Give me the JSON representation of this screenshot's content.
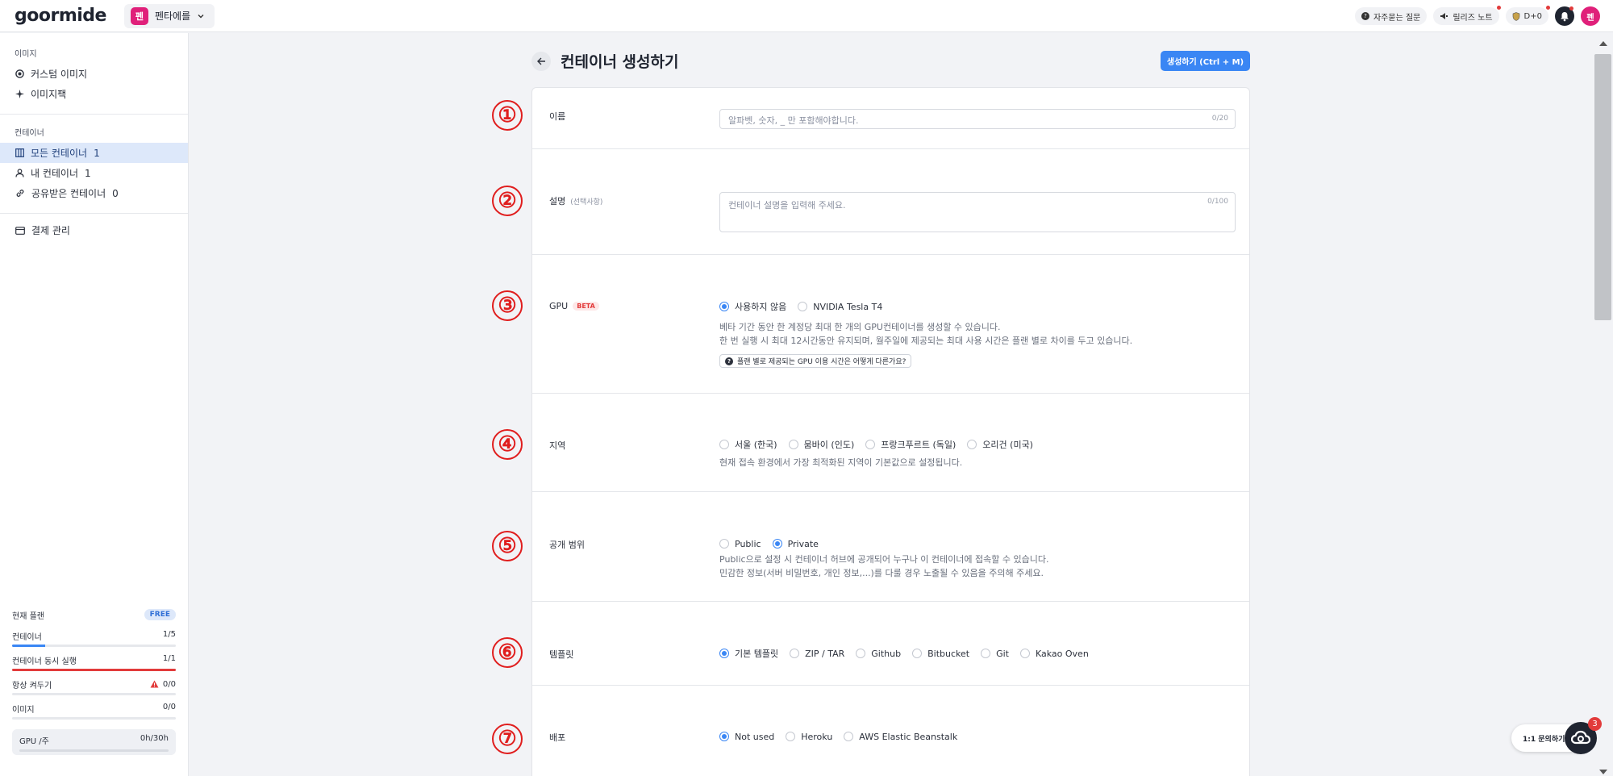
{
  "topbar": {
    "logo": "goormide",
    "org_badge": "펜",
    "org_name": "펜타에를",
    "faq": "자주묻는 질문",
    "release": "릴리즈 노트",
    "dday": "D+0",
    "avatar": "펜",
    "bell_badge": "0"
  },
  "sidebar": {
    "image_section": "이미지",
    "image_items": [
      {
        "label": "커스텀 이미지",
        "icon": "circle-dot-icon"
      },
      {
        "label": "이미지팩",
        "icon": "sparkle-icon"
      }
    ],
    "container_section": "컨테이너",
    "container_items": [
      {
        "label": "모든 컨테이너",
        "count": "1",
        "icon": "grid-icon",
        "active": true
      },
      {
        "label": "내 컨테이너",
        "count": "1",
        "icon": "user-icon"
      },
      {
        "label": "공유받은 컨테이너",
        "count": "0",
        "icon": "link-icon"
      }
    ],
    "billing": "결제 관리",
    "plan": {
      "title": "현재 플랜",
      "badge": "FREE",
      "rows": [
        {
          "label": "컨테이너",
          "value": "1/5",
          "fill": 0.2,
          "color": "#3a86f4"
        },
        {
          "label": "컨테이너 동시 실행",
          "value": "1/1",
          "fill": 1.0,
          "color": "#e23b3b"
        },
        {
          "label": "항상 켜두기",
          "value": "0/0",
          "fill": 0,
          "color": "#3a86f4",
          "warn": true
        },
        {
          "label": "이미지",
          "value": "0/0",
          "fill": 0,
          "color": "#3a86f4"
        }
      ],
      "gpu_label": "GPU /주",
      "gpu_value": "0h/30h"
    }
  },
  "main": {
    "title": "컨테이너 생성하기",
    "create_button": "생성하기 (Ctrl + M)",
    "name": {
      "number": "①",
      "label": "이름",
      "placeholder": "알파벳, 숫자, _ 만 포함해야합니다.",
      "counter": "0/20"
    },
    "description": {
      "number": "②",
      "label": "설명",
      "optional": "(선택사항)",
      "placeholder": "컨테이너 설명을 입력해 주세요.",
      "counter": "0/100"
    },
    "gpu": {
      "number": "③",
      "label": "GPU",
      "beta": "BETA",
      "options": [
        "사용하지 않음",
        "NVIDIA Tesla T4"
      ],
      "selected": 0,
      "help1": "베타 기간 동안 한 계정당 최대 한 개의 GPU컨테이너를 생성할 수 있습니다.",
      "help2": "한 번 실행 시 최대 12시간동안 유지되며, 월주일에 제공되는 최대 사용 시간은 플랜 별로 차이를 두고 있습니다.",
      "question": "플랜 별로 제공되는 GPU 이용 시간은 어떻게 다른가요?"
    },
    "region": {
      "number": "④",
      "label": "지역",
      "options": [
        "서울 (한국)",
        "뭄바이 (인도)",
        "프랑크푸르트 (독일)",
        "오리건 (미국)"
      ],
      "selected": -1,
      "help": "현재 접속 환경에서 가장 최적화된 지역이 기본값으로 설정됩니다."
    },
    "visibility": {
      "number": "⑤",
      "label": "공개 범위",
      "options": [
        "Public",
        "Private"
      ],
      "selected": 1,
      "help1": "Public으로 설정 시 컨테이너 허브에 공개되어 누구나 이 컨테이너에 접속할 수 있습니다.",
      "help2": "민감한 정보(서버 비밀번호, 개인 정보,...)를 다룰 경우 노출될 수 있음을 주의해 주세요."
    },
    "template": {
      "number": "⑥",
      "label": "템플릿",
      "options": [
        "기본 템플릿",
        "ZIP / TAR",
        "Github",
        "Bitbucket",
        "Git",
        "Kakao Oven"
      ],
      "selected": 0
    },
    "deploy": {
      "number": "⑦",
      "label": "배포",
      "options": [
        "Not used",
        "Heroku",
        "AWS Elastic Beanstalk"
      ],
      "selected": 0
    }
  },
  "chat": {
    "label": "1:1 문의하기",
    "badge": "3"
  },
  "colors": {
    "accent": "#3a86f4",
    "danger": "#e23b3b",
    "brand": "#e0207a"
  }
}
